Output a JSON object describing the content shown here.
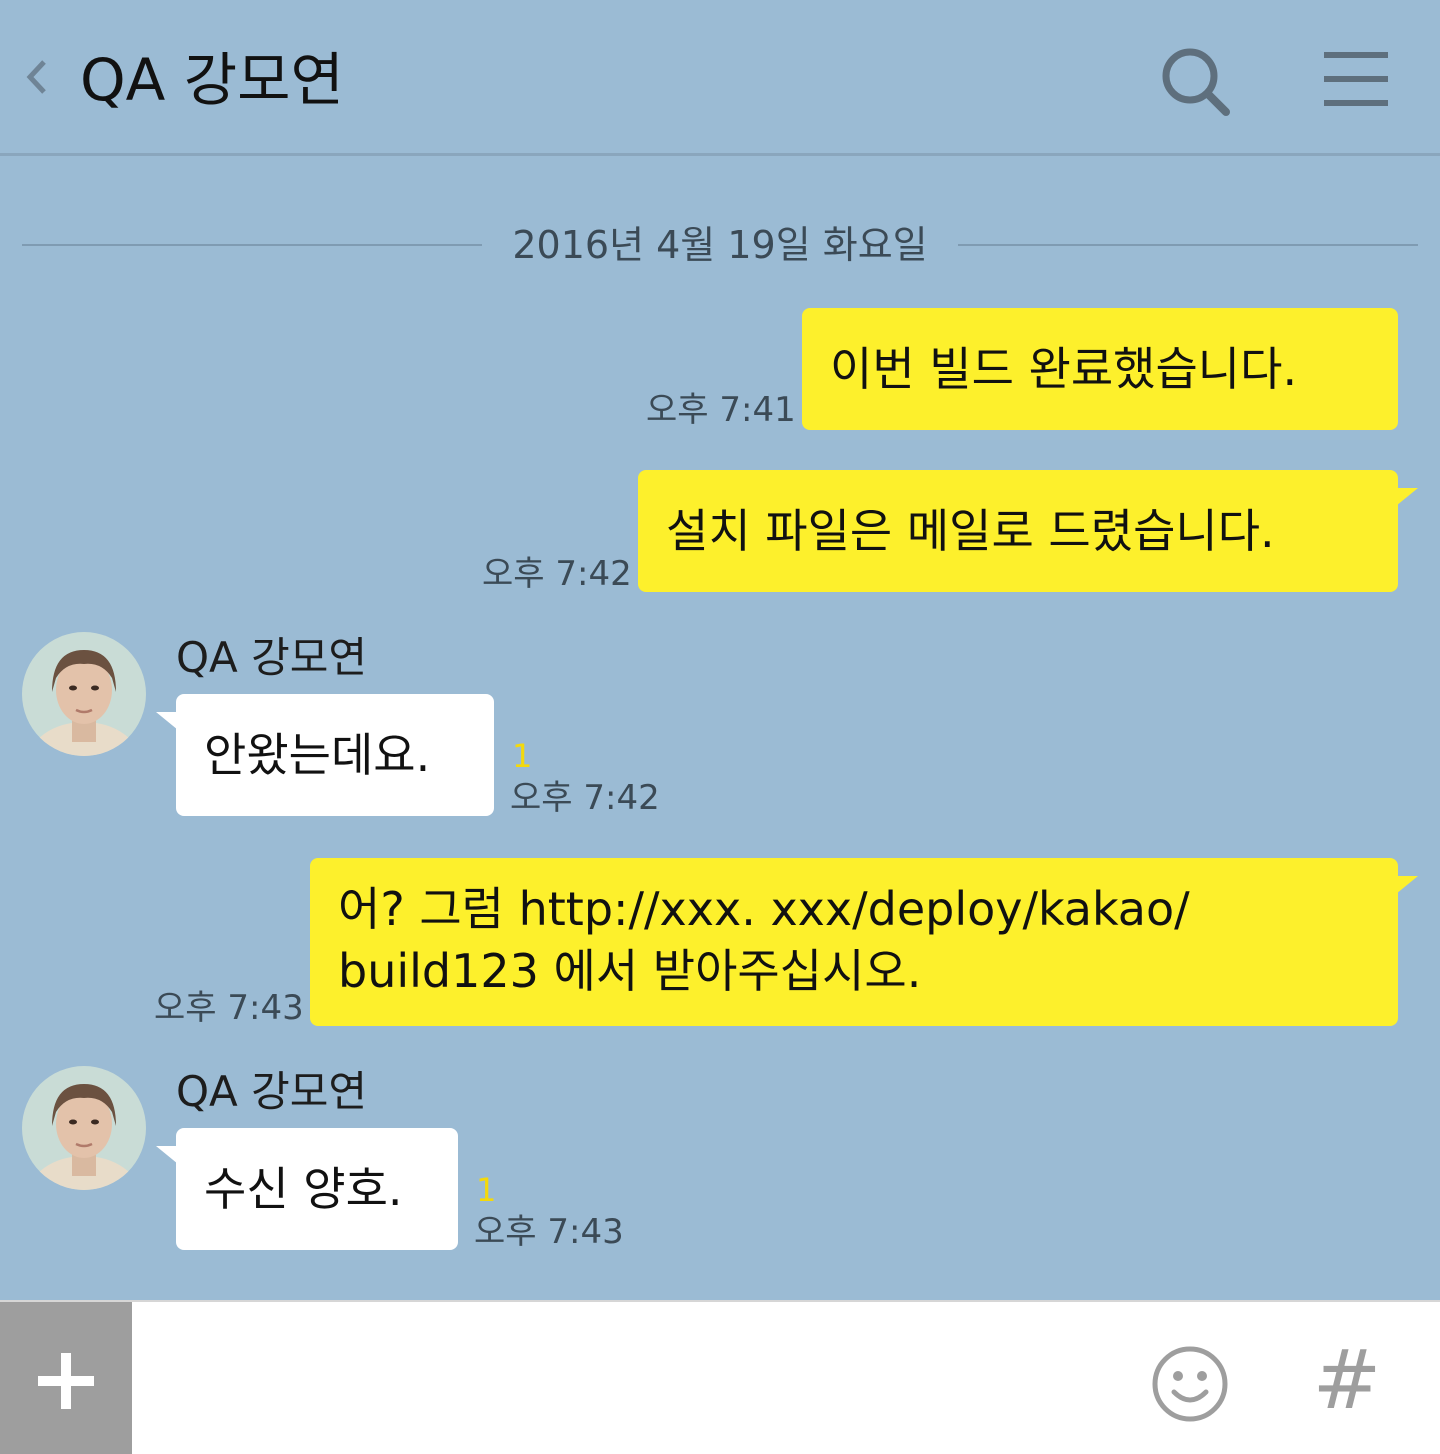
{
  "header": {
    "back_icon": "chevron-left-icon",
    "title": "QA 강모연",
    "search_icon": "search-icon",
    "menu_icon": "menu-icon"
  },
  "date_divider": "2016년 4월 19일 화요일",
  "messages": [
    {
      "from": "me",
      "text": "이번 빌드 완료했습니다.",
      "time": "오후 7:41"
    },
    {
      "from": "me",
      "text": "설치 파일은 메일로 드렸습니다.",
      "time": "오후 7:42"
    },
    {
      "from": "QA 강모연",
      "text": "안왔는데요.",
      "time": "오후 7:42",
      "unread": "1"
    },
    {
      "from": "me",
      "lines": [
        "어? 그럼 http://xxx. xxx/deploy/kakao/",
        "build123 에서 받아주십시오."
      ],
      "time": "오후 7:43"
    },
    {
      "from": "QA 강모연",
      "text": "수신 양호.",
      "time": "오후 7:43",
      "unread": "1"
    }
  ],
  "input_bar": {
    "plus_icon": "plus-icon",
    "emoji_icon": "emoji-icon",
    "hash_icon": "#"
  },
  "colors": {
    "background": "#9bbbd4",
    "my_bubble": "#fdf02c",
    "their_bubble": "#ffffff",
    "unread": "#f4d90b"
  }
}
